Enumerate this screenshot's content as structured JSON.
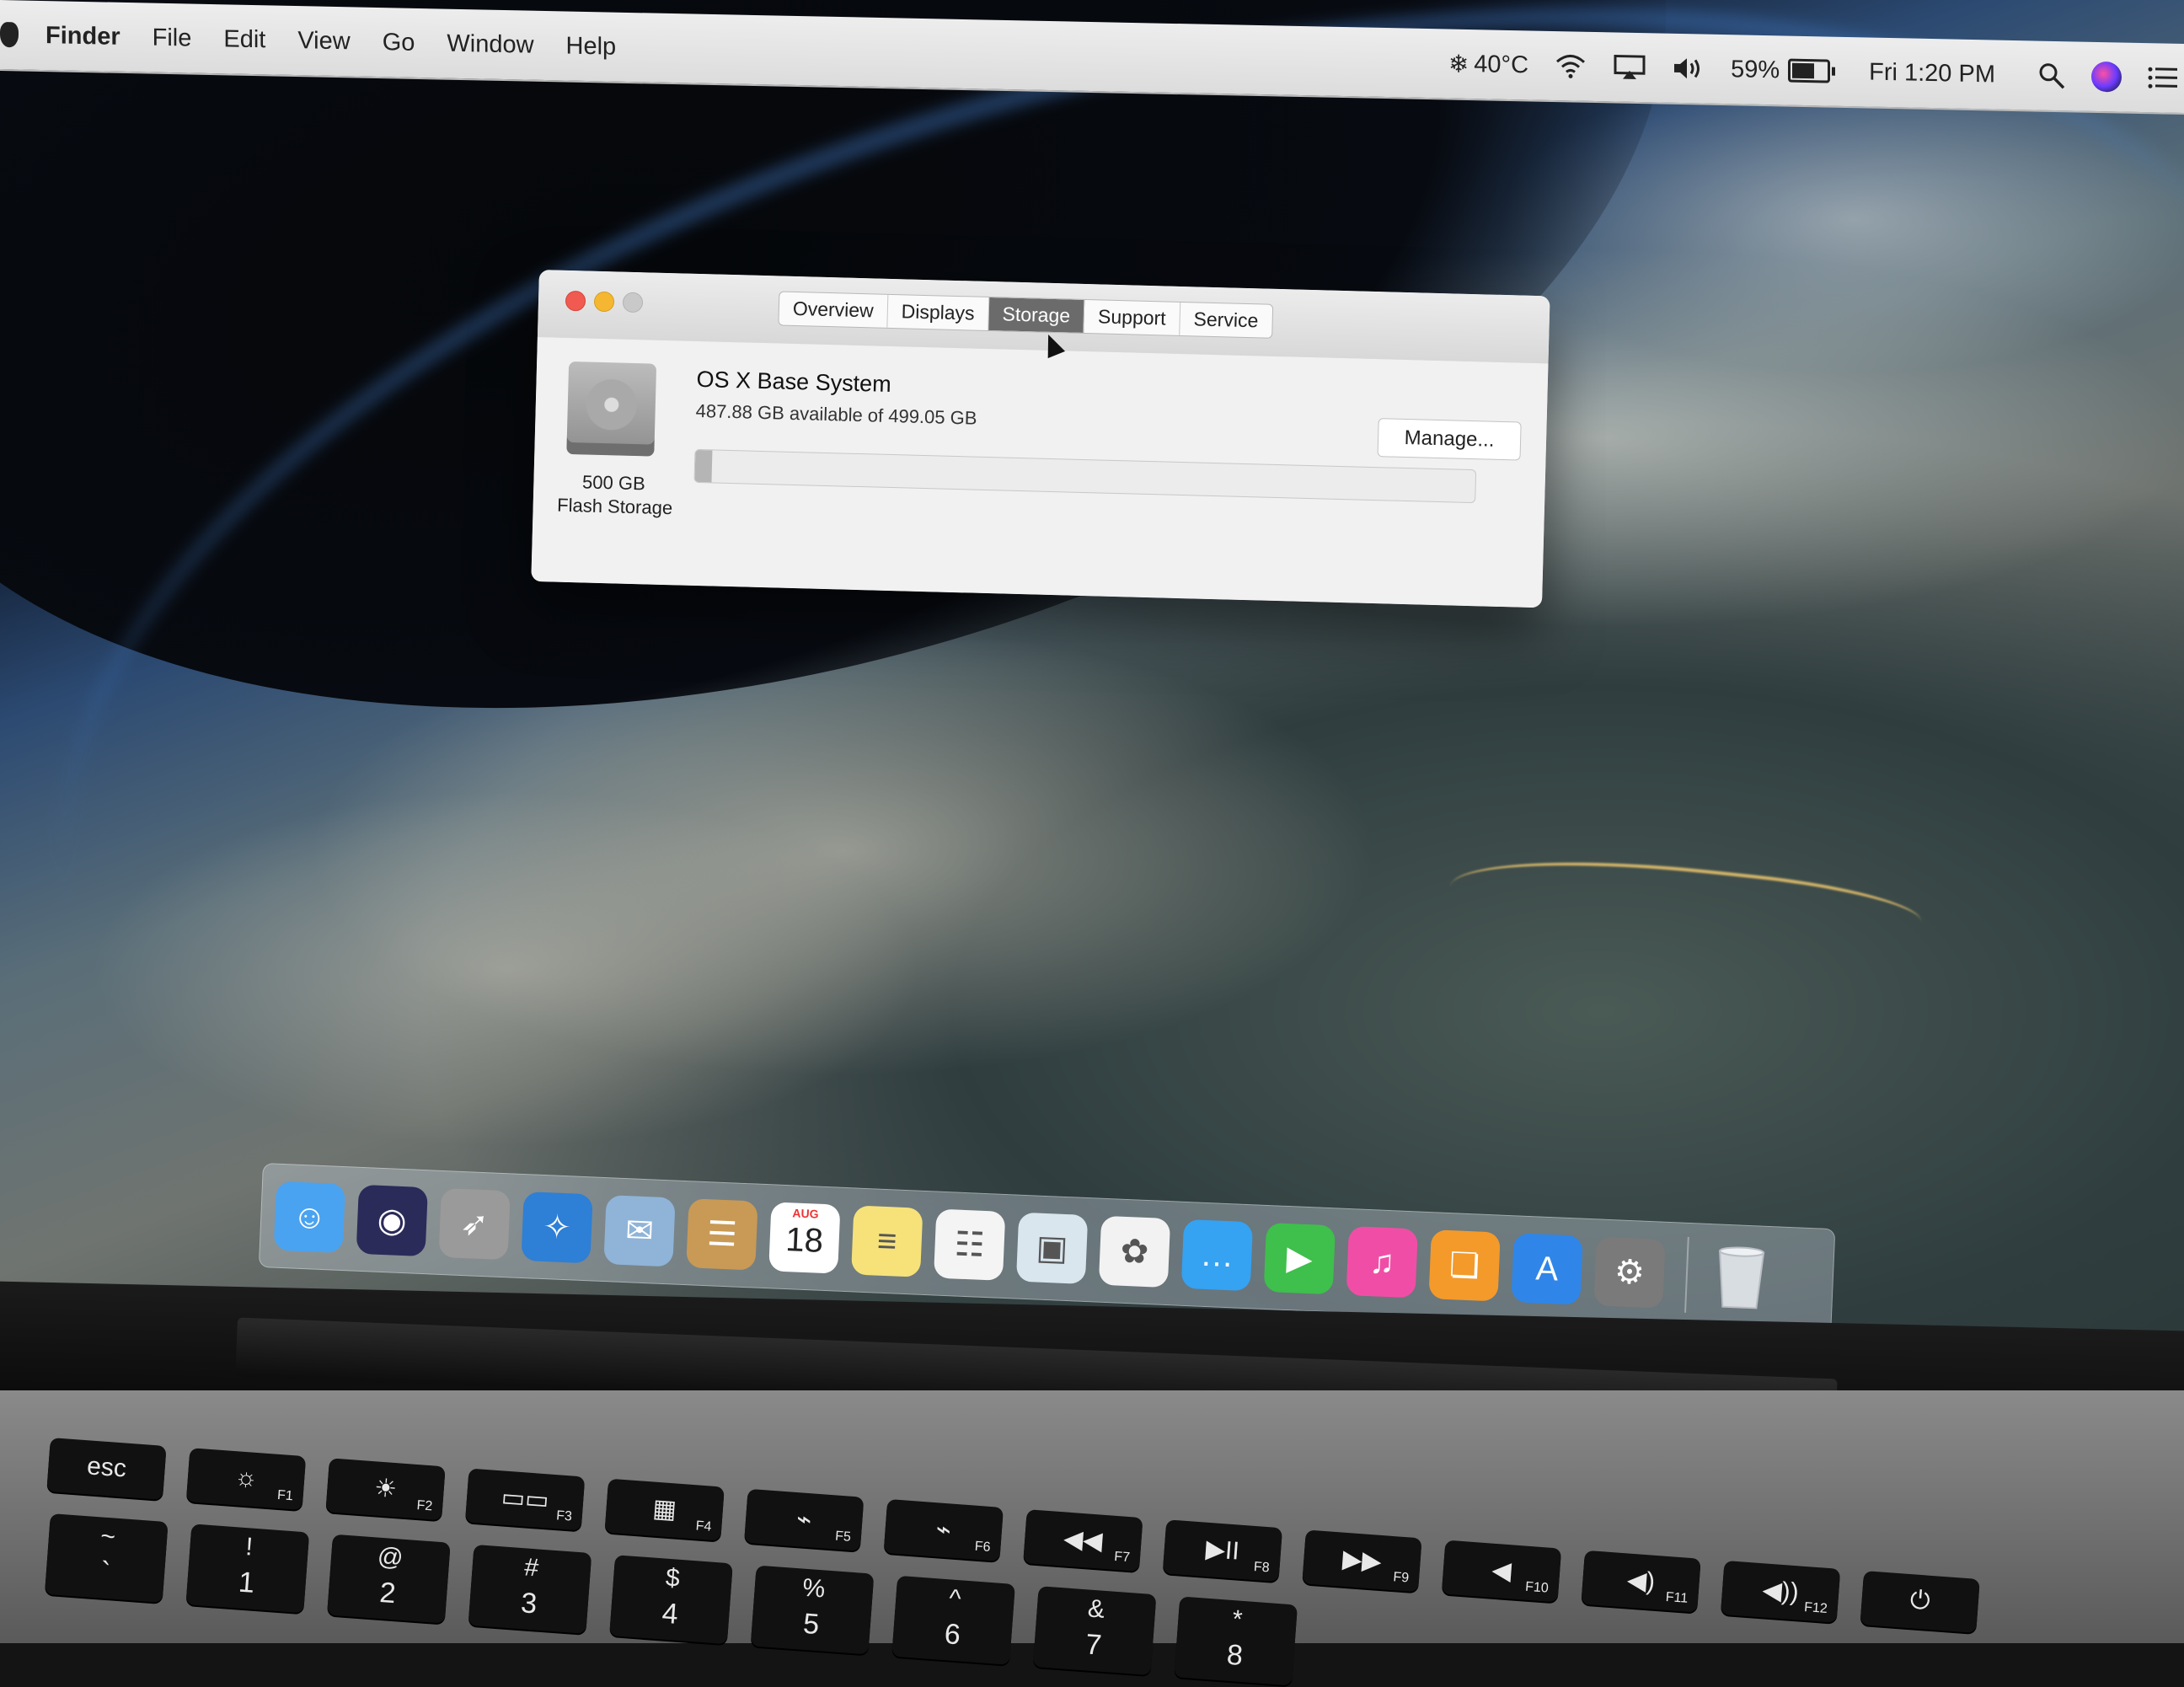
{
  "menubar": {
    "app_name": "Finder",
    "items": [
      "File",
      "Edit",
      "View",
      "Go",
      "Window",
      "Help"
    ],
    "status": {
      "temperature": "40°C",
      "battery_percent": "59%",
      "battery_level": 0.59,
      "clock": "Fri 1:20 PM"
    }
  },
  "window": {
    "tabs": [
      "Overview",
      "Displays",
      "Storage",
      "Support",
      "Service"
    ],
    "active_tab": "Storage",
    "disk": {
      "size": "500 GB",
      "type": "Flash Storage"
    },
    "volume": {
      "name": "OS X Base System",
      "availability": "487.88 GB available of 499.05 GB",
      "used_fraction": 0.022
    },
    "manage_label": "Manage..."
  },
  "dock": {
    "apps": [
      {
        "name": "Finder",
        "icon": "finder-icon",
        "color": "#4aa3f0"
      },
      {
        "name": "Siri",
        "icon": "siri-icon",
        "color": "#2b2b5a"
      },
      {
        "name": "Launchpad",
        "icon": "rocket-icon",
        "color": "#9a9a9a"
      },
      {
        "name": "Safari",
        "icon": "compass-icon",
        "color": "#2e7fd6"
      },
      {
        "name": "Mail",
        "icon": "stamp-icon",
        "color": "#8fb4d8"
      },
      {
        "name": "Contacts",
        "icon": "contacts-book-icon",
        "color": "#c99a55"
      },
      {
        "name": "Calendar",
        "icon": "calendar-icon",
        "color": "#ffffff",
        "month": "AUG",
        "day": "18"
      },
      {
        "name": "Notes",
        "icon": "notes-icon",
        "color": "#f7e27a"
      },
      {
        "name": "Reminders",
        "icon": "reminders-icon",
        "color": "#f4f4f4"
      },
      {
        "name": "Preview",
        "icon": "preview-icon",
        "color": "#d9e6ee"
      },
      {
        "name": "Photos",
        "icon": "photos-flower-icon",
        "color": "#f2f2f2"
      },
      {
        "name": "Messages",
        "icon": "speech-bubbles-icon",
        "color": "#35a2f2"
      },
      {
        "name": "FaceTime",
        "icon": "video-camera-icon",
        "color": "#3fbf4c"
      },
      {
        "name": "iTunes",
        "icon": "music-note-icon",
        "color": "#f04ea6"
      },
      {
        "name": "iBooks",
        "icon": "open-book-icon",
        "color": "#f39a2b"
      },
      {
        "name": "App Store",
        "icon": "app-store-icon",
        "color": "#2f86e8"
      },
      {
        "name": "System Preferences",
        "icon": "gear-icon",
        "color": "#7a7a7a"
      }
    ],
    "trash": {
      "name": "Trash",
      "icon": "trash-icon",
      "color": "#d8dde2"
    }
  },
  "keyboard": {
    "function_row": [
      {
        "main": "esc",
        "sub": ""
      },
      {
        "main": "☼",
        "sub": "F1"
      },
      {
        "main": "☀",
        "sub": "F2"
      },
      {
        "main": "▭▭",
        "sub": "F3"
      },
      {
        "main": "▦",
        "sub": "F4"
      },
      {
        "main": "⌁",
        "sub": "F5"
      },
      {
        "main": "⌁",
        "sub": "F6"
      },
      {
        "main": "◀◀",
        "sub": "F7"
      },
      {
        "main": "▶II",
        "sub": "F8"
      },
      {
        "main": "▶▶",
        "sub": "F9"
      },
      {
        "main": "◀",
        "sub": "F10"
      },
      {
        "main": "◀)",
        "sub": "F11"
      },
      {
        "main": "◀))",
        "sub": "F12"
      },
      {
        "main": "⏻",
        "sub": ""
      }
    ],
    "number_row": [
      {
        "top": "~",
        "bottom": "`"
      },
      {
        "top": "!",
        "bottom": "1"
      },
      {
        "top": "@",
        "bottom": "2"
      },
      {
        "top": "#",
        "bottom": "3"
      },
      {
        "top": "$",
        "bottom": "4"
      },
      {
        "top": "%",
        "bottom": "5"
      },
      {
        "top": "^",
        "bottom": "6"
      },
      {
        "top": "&",
        "bottom": "7"
      },
      {
        "top": "*",
        "bottom": "8"
      }
    ]
  }
}
